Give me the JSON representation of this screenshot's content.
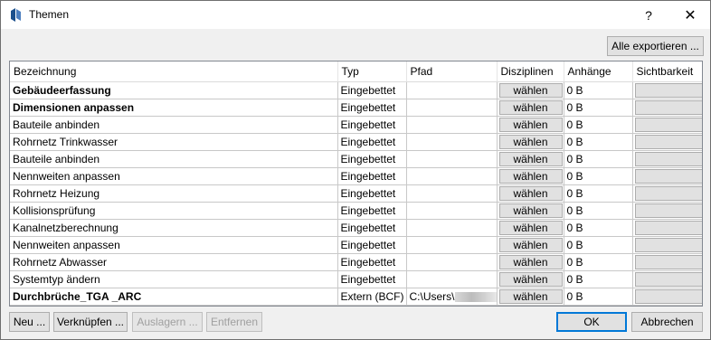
{
  "window": {
    "title": "Themen",
    "help_glyph": "?",
    "close_glyph": "✕"
  },
  "toolbar": {
    "export_all": "Alle exportieren ..."
  },
  "columns": [
    "Bezeichnung",
    "Typ",
    "Pfad",
    "Disziplinen",
    "Anhänge",
    "Sichtbarkeit"
  ],
  "rows": [
    {
      "name": "Gebäudeerfassung",
      "bold": true,
      "type": "Eingebettet",
      "path": "",
      "disc": "wählen",
      "att": "0 B"
    },
    {
      "name": "Dimensionen anpassen",
      "bold": true,
      "type": "Eingebettet",
      "path": "",
      "disc": "wählen",
      "att": "0 B"
    },
    {
      "name": "Bauteile anbinden",
      "bold": false,
      "type": "Eingebettet",
      "path": "",
      "disc": "wählen",
      "att": "0 B"
    },
    {
      "name": "Rohrnetz Trinkwasser",
      "bold": false,
      "type": "Eingebettet",
      "path": "",
      "disc": "wählen",
      "att": "0 B"
    },
    {
      "name": "Bauteile anbinden",
      "bold": false,
      "type": "Eingebettet",
      "path": "",
      "disc": "wählen",
      "att": "0 B"
    },
    {
      "name": "Nennweiten anpassen",
      "bold": false,
      "type": "Eingebettet",
      "path": "",
      "disc": "wählen",
      "att": "0 B"
    },
    {
      "name": "Rohrnetz Heizung",
      "bold": false,
      "type": "Eingebettet",
      "path": "",
      "disc": "wählen",
      "att": "0 B"
    },
    {
      "name": "Kollisionsprüfung",
      "bold": false,
      "type": "Eingebettet",
      "path": "",
      "disc": "wählen",
      "att": "0 B"
    },
    {
      "name": "Kanalnetzberechnung",
      "bold": false,
      "type": "Eingebettet",
      "path": "",
      "disc": "wählen",
      "att": "0 B"
    },
    {
      "name": "Nennweiten anpassen",
      "bold": false,
      "type": "Eingebettet",
      "path": "",
      "disc": "wählen",
      "att": "0 B"
    },
    {
      "name": "Rohrnetz Abwasser",
      "bold": false,
      "type": "Eingebettet",
      "path": "",
      "disc": "wählen",
      "att": "0 B"
    },
    {
      "name": "Systemtyp ändern",
      "bold": false,
      "type": "Eingebettet",
      "path": "",
      "disc": "wählen",
      "att": "0 B"
    },
    {
      "name": "Durchbrüche_TGA _ARC",
      "bold": true,
      "type": "Extern (BCF)",
      "path": "C:\\Users\\",
      "disc": "wählen",
      "att": "0 B"
    }
  ],
  "footer": {
    "new": "Neu ...",
    "link": "Verknüpfen ...",
    "outsource": "Auslagern ...",
    "remove": "Entfernen",
    "ok": "OK",
    "cancel": "Abbrechen"
  }
}
